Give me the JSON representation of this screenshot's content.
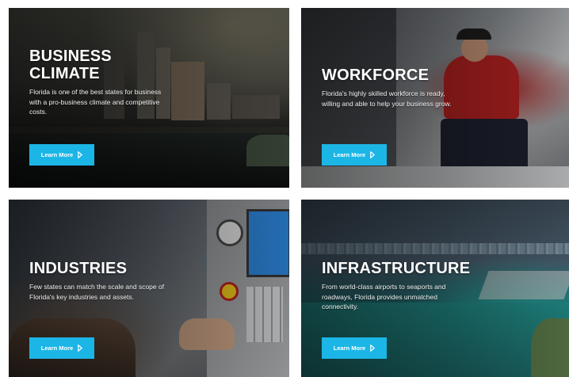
{
  "cards": [
    {
      "id": "business",
      "title_line1": "BUSINESS",
      "title_line2": "CLIMATE",
      "description": "Florida is one of the best states for business with a pro-business climate and competitive costs.",
      "button_label": "Learn More"
    },
    {
      "id": "workforce",
      "title_line1": "WORKFORCE",
      "description": "Florida's highly skilled workforce is ready, willing and able to help your business grow.",
      "button_label": "Learn More"
    },
    {
      "id": "industries",
      "title_line1": "INDUSTRIES",
      "description": "Few states can match the scale and scope of Florida's key industries and assets.",
      "button_label": "Learn More"
    },
    {
      "id": "infrastructure",
      "title_line1": "INFRASTRUCTURE",
      "description": "From world-class airports to seaports and roadways, Florida provides unmatched connectivity.",
      "button_label": "Learn More"
    }
  ],
  "colors": {
    "button": "#1cb6e6",
    "text": "#ffffff"
  },
  "icons": {
    "button_icon": "play-triangle-outline-icon"
  }
}
